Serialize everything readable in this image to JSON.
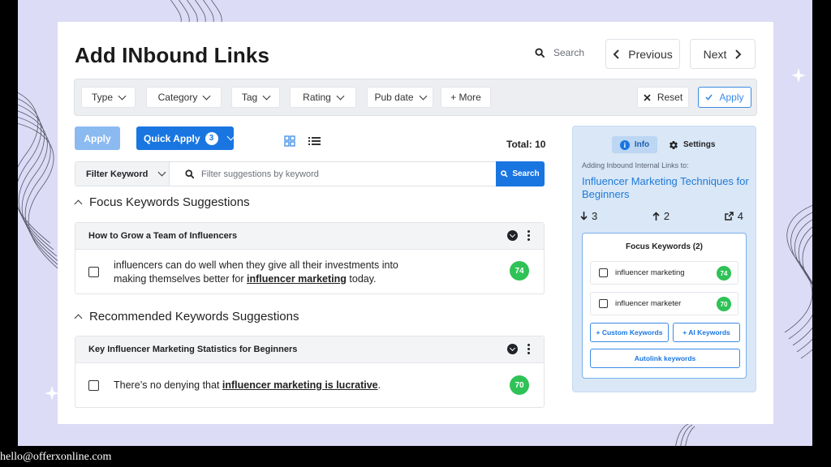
{
  "page": {
    "title": "Add INbound Links",
    "search_label": "Search",
    "previous_label": "Previous",
    "next_label": "Next"
  },
  "filters": {
    "type": "Type",
    "category": "Category",
    "tag": "Tag",
    "rating": "Rating",
    "pub_date": "Pub date",
    "more": "+ More",
    "reset": "Reset",
    "apply": "Apply"
  },
  "actions": {
    "apply_label": "Apply",
    "quick_apply_label": "Quick Apply",
    "quick_apply_count": "3",
    "total_label": "Total: 10"
  },
  "keyword_filter": {
    "select_label": "Filter Keyword",
    "placeholder": "Filter suggestions by keyword",
    "search_button": "Search"
  },
  "focus_section": {
    "heading": "Focus Keywords Suggestions",
    "card_title": "How to Grow a Team of Influencers",
    "text_before": "influencers can do well when they give all their investments into making themselves better for ",
    "text_keyword": "influencer marketing",
    "text_after": " today.",
    "score": "74"
  },
  "recommended_section": {
    "heading": "Recommended Keywords Suggestions",
    "card_title": "Key Influencer Marketing Statistics for Beginners",
    "text_before": "There’s no denying that ",
    "text_keyword": "influencer marketing is lucrative",
    "text_after": ".",
    "score": "70"
  },
  "side_panel": {
    "tab_info": "Info",
    "tab_settings": "Settings",
    "subtitle": "Adding Inbound Internal Links to:",
    "post_title": "Influencer Marketing Techniques for Beginners",
    "stat_down": "3",
    "stat_up": "2",
    "stat_external": "4",
    "focus_title": "Focus Keywords (2)",
    "keywords": [
      {
        "label": "influencer marketing",
        "score": "74"
      },
      {
        "label": "influencer marketer",
        "score": "70"
      }
    ],
    "custom_btn": "+ Custom Keywords",
    "ai_btn": "+ AI Keywords",
    "autolink_btn": "Autolink keywords"
  },
  "footer": {
    "email": "hello@offerxonline.com"
  },
  "colors": {
    "accent": "#1976e1",
    "score_green": "#2fc256",
    "stage_bg": "#dcdcf6"
  }
}
